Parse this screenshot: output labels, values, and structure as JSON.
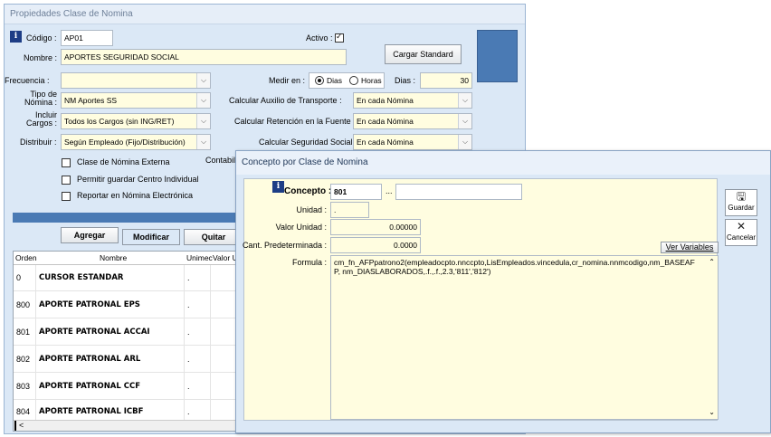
{
  "main_window": {
    "title": "Propiedades Clase de Nomina",
    "codigo_label": "Código :",
    "codigo_value": "AP01",
    "activo_label": "Activo :",
    "activo_checked": true,
    "nombre_label": "Nombre :",
    "nombre_value": "APORTES SEGURIDAD SOCIAL",
    "cargar_standard": "Cargar Standard",
    "frecuencia_label": "Frecuencia :",
    "frecuencia_value": "",
    "medir_label": "Medir en :",
    "medir_dias": "Dias",
    "medir_horas": "Horas",
    "dias_label": "Dias :",
    "dias_value": "30",
    "tipo_nomina_label_1": "Tipo de",
    "tipo_nomina_label_2": "Nómina :",
    "tipo_nomina_value": "NM Aportes SS",
    "auxilio_label": "Calcular Auxilio de Transporte :",
    "auxilio_value": "En cada Nómina",
    "incluir_label_1": "Incluir",
    "incluir_label_2": "Cargos :",
    "incluir_value": "Todos los Cargos (sin ING/RET)",
    "retencion_label": "Calcular Retención en la Fuente :",
    "retencion_value": "En cada Nómina",
    "distribuir_label": "Distribuir :",
    "distribuir_value": "Según Empleado (Fijo/Distribución)",
    "seguridad_label": "Calcular Seguridad Social :",
    "seguridad_value": "En cada Nómina",
    "chk_externa": "Clase de Nómina Externa",
    "chk_centro": "Permitir guardar Centro Individual",
    "chk_electronica": "Reportar en Nómina Electrónica",
    "contable_partial": "Contabil",
    "btn_agregar": "Agregar",
    "btn_modificar": "Modificar",
    "btn_quitar": "Quitar"
  },
  "grid": {
    "headers": [
      "Orden",
      "Nombre",
      "Unimec",
      "Valor U"
    ],
    "rows": [
      {
        "orden": "0",
        "nombre": "CURSOR ESTANDAR",
        "unidad": "."
      },
      {
        "orden": "800",
        "nombre": "APORTE PATRONAL EPS",
        "unidad": "."
      },
      {
        "orden": "801",
        "nombre": "APORTE PATRONAL ACCAI",
        "unidad": "."
      },
      {
        "orden": "802",
        "nombre": "APORTE PATRONAL ARL",
        "unidad": "."
      },
      {
        "orden": "803",
        "nombre": "APORTE PATRONAL CCF",
        "unidad": "."
      },
      {
        "orden": "804",
        "nombre": "APORTE PATRONAL ICBF",
        "unidad": "."
      }
    ],
    "scroll_left": "<"
  },
  "dialog": {
    "title": "Concepto por Clase de Nomina",
    "concepto_label": "Concepto :",
    "concepto_value": "801",
    "concepto_ellipsis": "...",
    "concepto_desc": "",
    "unidad_label": "Unidad :",
    "unidad_value": ".",
    "valor_unidad_label": "Valor Unidad :",
    "valor_unidad_value": "0.00000",
    "cant_label": "Cant. Predeterminada :",
    "cant_value": "0.0000",
    "ver_variables": "Ver Variables",
    "formula_label": "Formula :",
    "formula_value": "cm_fn_AFPpatrono2(empleadocpto.nnccpto,LisEmpleados.vincedula,cr_nomina.nnmcodigo,nm_BASEAFP, nm_DIASLABORADOS,.f.,.f.,2.3,'811','812')",
    "guardar": "Guardar",
    "cancelar": "Cancelar"
  }
}
